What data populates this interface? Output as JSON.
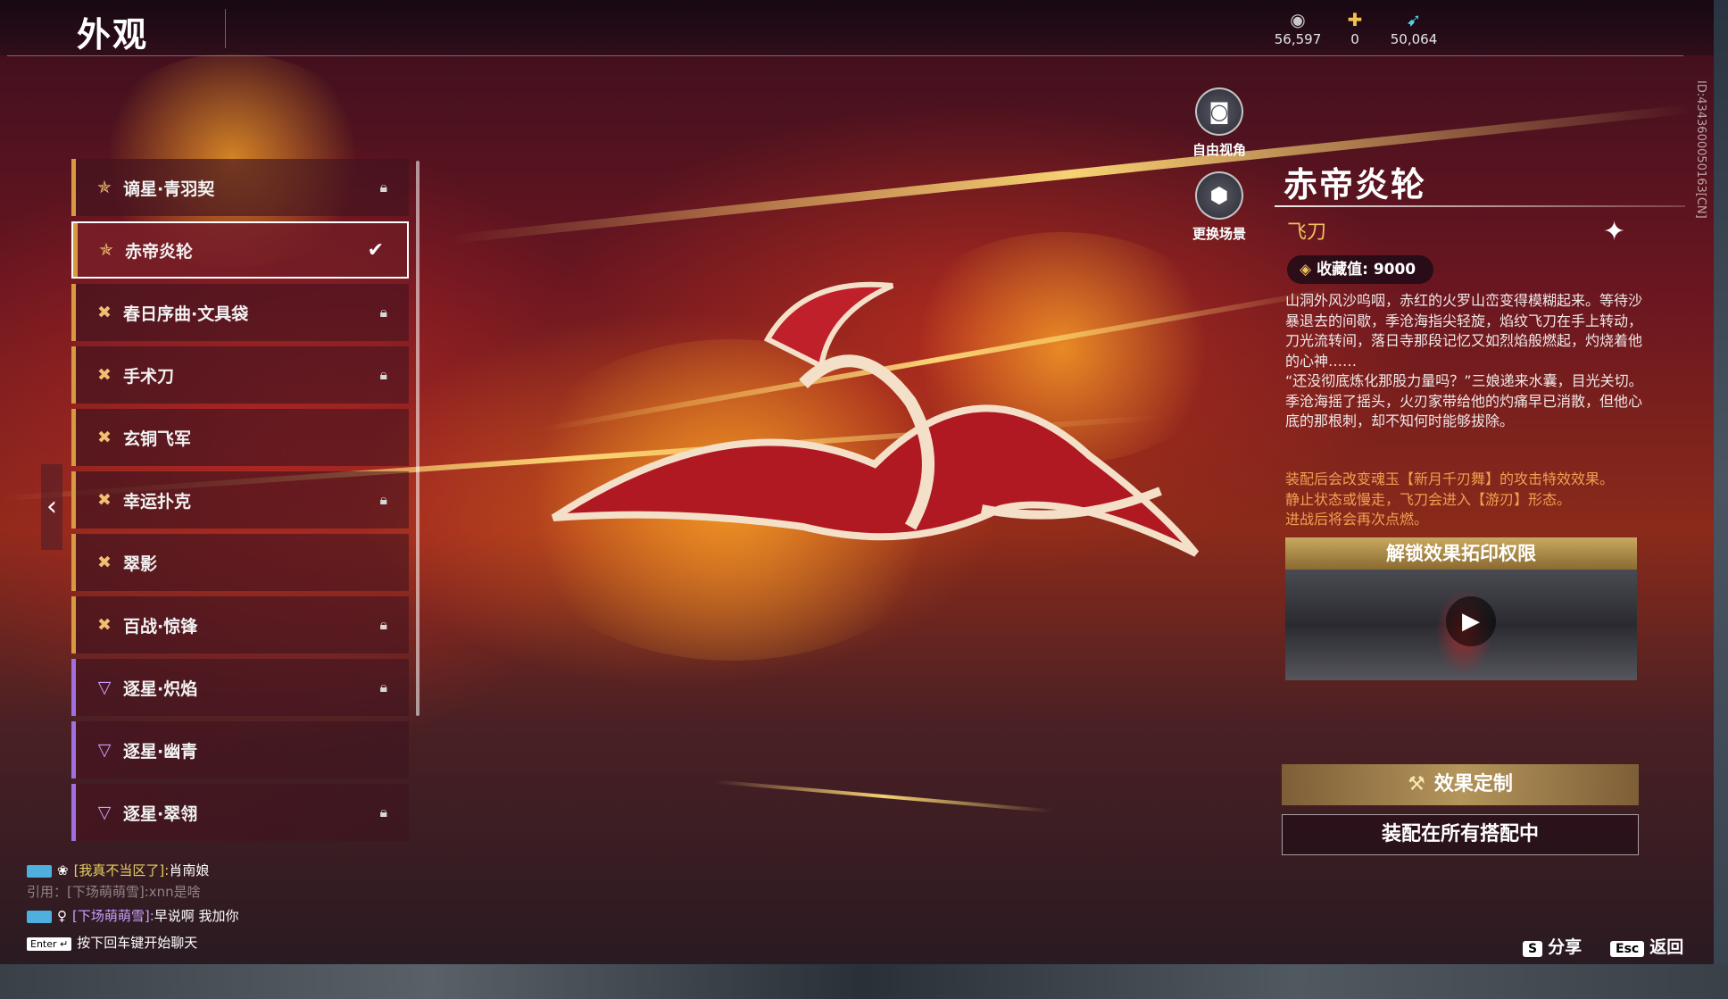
{
  "header": {
    "title": "外观",
    "currencies": [
      {
        "icon": "coin-stack-icon",
        "glyph": "◉",
        "value": "56,597",
        "color": "#c8c8c8"
      },
      {
        "icon": "ticket-icon",
        "glyph": "✚",
        "value": "0",
        "color": "#f0c050"
      },
      {
        "icon": "feather-icon",
        "glyph": "➹",
        "value": "50,064",
        "color": "#5ad0e0"
      }
    ]
  },
  "side_id": "ID:43436000501​63[CN]",
  "camera": {
    "free_view": "自由视角",
    "change_scene": "更换场景"
  },
  "list": {
    "items": [
      {
        "label": "谪星·青羽契",
        "tier": "gold",
        "locked": true
      },
      {
        "label": "赤帝炎轮",
        "tier": "gold",
        "locked": false,
        "selected": true
      },
      {
        "label": "春日序曲·文具袋",
        "tier": "gold",
        "locked": true
      },
      {
        "label": "手术刀",
        "tier": "gold",
        "locked": true
      },
      {
        "label": "玄铜飞军",
        "tier": "gold",
        "locked": false
      },
      {
        "label": "幸运扑克",
        "tier": "gold",
        "locked": true
      },
      {
        "label": "翠影",
        "tier": "gold",
        "locked": false
      },
      {
        "label": "百战·惊锋",
        "tier": "gold",
        "locked": true
      },
      {
        "label": "逐星·炽焰",
        "tier": "purple",
        "locked": true
      },
      {
        "label": "逐星·幽青",
        "tier": "purple",
        "locked": false
      },
      {
        "label": "逐星·翠翎",
        "tier": "purple",
        "locked": true
      }
    ]
  },
  "detail": {
    "name": "赤帝炎轮",
    "type": "飞刀",
    "collection_label": "收藏值:",
    "collection_value": "9000",
    "description": [
      "山洞外风沙呜咽，赤红的火罗山峦变得模糊起来。等待沙暴退去的间歇，季沧海指尖轻旋，焰纹飞刀在手上转动，刀光流转间，落日寺那段记忆又如烈焰般燃起，灼烧着他的心神……",
      "“还没彻底炼化那股力量吗？”三娘递来水囊，目光关切。",
      "季沧海摇了摇头，火刃家带给他的灼痛早已消散，但他心底的那根刺，却不知何时能够拔除。"
    ],
    "effect": [
      "装配后会改变魂玉【新月千刃舞】的攻击特效效果。",
      "静止状态或慢走，飞刀会进入【游刃】形态。",
      "进战后将会再次点燃。"
    ],
    "unlock_title": "解锁效果拓印权限",
    "custom_label": "效果定制",
    "equip_label": "装配在所有搭配中"
  },
  "chat": {
    "line1_channel": "[我真不当区了]:",
    "line1_msg": "肖南娘",
    "line2": "引用：[下场萌萌雪]:xnn是啥",
    "line3_channel": "[下场萌萌雪]:",
    "line3_msg": "早说啊 我加你",
    "line4_key": "Enter ↵",
    "line4_hint": "按下回车键开始聊天"
  },
  "hints": {
    "share_key": "S",
    "share_label": "分享",
    "back_key": "Esc",
    "back_label": "返回"
  }
}
